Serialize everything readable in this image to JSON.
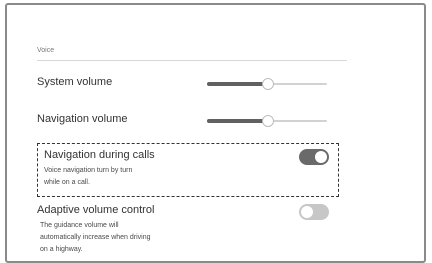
{
  "voice": {
    "section_label": "Voice",
    "system_volume": {
      "label": "System volume",
      "level": 0.5
    },
    "navigation_volume": {
      "label": "Navigation volume",
      "level": 0.5
    },
    "navigation_during_calls": {
      "label": "Navigation during calls",
      "desc_line1": "Voice navigation turn by turn",
      "desc_line2": "while on a call.",
      "enabled": true
    },
    "adaptive_volume": {
      "label": "Adaptive volume control",
      "desc_line1": "The guidance volume will",
      "desc_line2": "automatically increase when driving",
      "desc_line3": "on a highway.",
      "enabled": false
    }
  },
  "colors": {
    "toggle_on": "#6a6a6a",
    "toggle_off": "#c7c7c7",
    "slider_fill": "#616161"
  }
}
